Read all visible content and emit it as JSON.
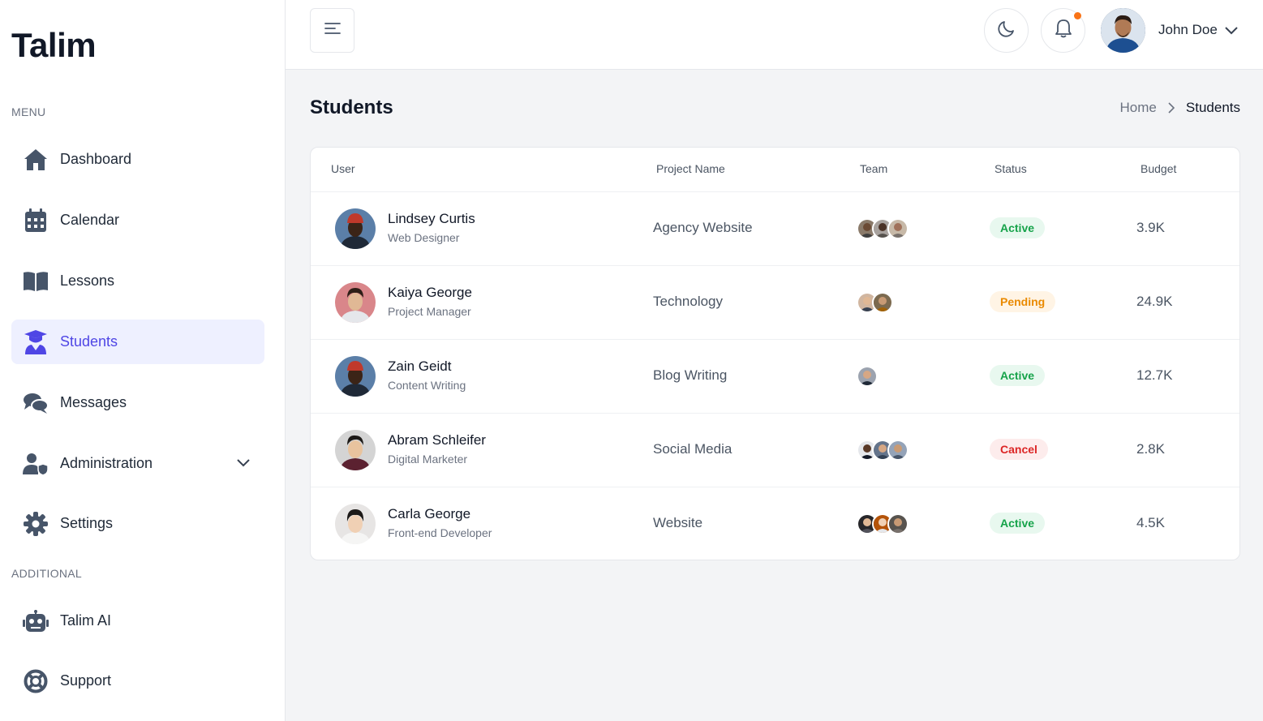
{
  "app": {
    "logo": "Talim"
  },
  "sidebar": {
    "menu_label": "MENU",
    "additional_label": "ADDITIONAL",
    "items": [
      {
        "label": "Dashboard",
        "icon": "home-icon"
      },
      {
        "label": "Calendar",
        "icon": "calendar-icon"
      },
      {
        "label": "Lessons",
        "icon": "book-icon"
      },
      {
        "label": "Students",
        "icon": "graduate-icon",
        "active": true
      },
      {
        "label": "Messages",
        "icon": "chat-icon"
      },
      {
        "label": "Administration",
        "icon": "user-shield-icon"
      },
      {
        "label": "Settings",
        "icon": "gear-icon"
      }
    ],
    "additional_items": [
      {
        "label": "Talim AI",
        "icon": "robot-icon"
      },
      {
        "label": "Support",
        "icon": "lifebuoy-icon"
      }
    ]
  },
  "header": {
    "user_name": "John Doe",
    "notification_color": "#f97316"
  },
  "page": {
    "title": "Students",
    "breadcrumb": {
      "home": "Home",
      "current": "Students"
    }
  },
  "table": {
    "columns": {
      "user": "User",
      "project": "Project Name",
      "team": "Team",
      "status": "Status",
      "budget": "Budget"
    },
    "rows": [
      {
        "name": "Lindsey Curtis",
        "role": "Web Designer",
        "project": "Agency Website",
        "team_count": 3,
        "status": "Active",
        "status_type": "active",
        "budget": "3.9K"
      },
      {
        "name": "Kaiya George",
        "role": "Project Manager",
        "project": "Technology",
        "team_count": 2,
        "status": "Pending",
        "status_type": "pending",
        "budget": "24.9K"
      },
      {
        "name": "Zain Geidt",
        "role": "Content Writing",
        "project": "Blog Writing",
        "team_count": 1,
        "status": "Active",
        "status_type": "active",
        "budget": "12.7K"
      },
      {
        "name": "Abram Schleifer",
        "role": "Digital Marketer",
        "project": "Social Media",
        "team_count": 3,
        "status": "Cancel",
        "status_type": "cancel",
        "budget": "2.8K"
      },
      {
        "name": "Carla George",
        "role": "Front-end Developer",
        "project": "Website",
        "team_count": 3,
        "status": "Active",
        "status_type": "active",
        "budget": "4.5K"
      }
    ]
  },
  "colors": {
    "accent": "#4f46e5",
    "active_bg": "#eef0ff",
    "status_active": "#16a34a",
    "status_pending": "#ea8a00",
    "status_cancel": "#dc2626"
  }
}
